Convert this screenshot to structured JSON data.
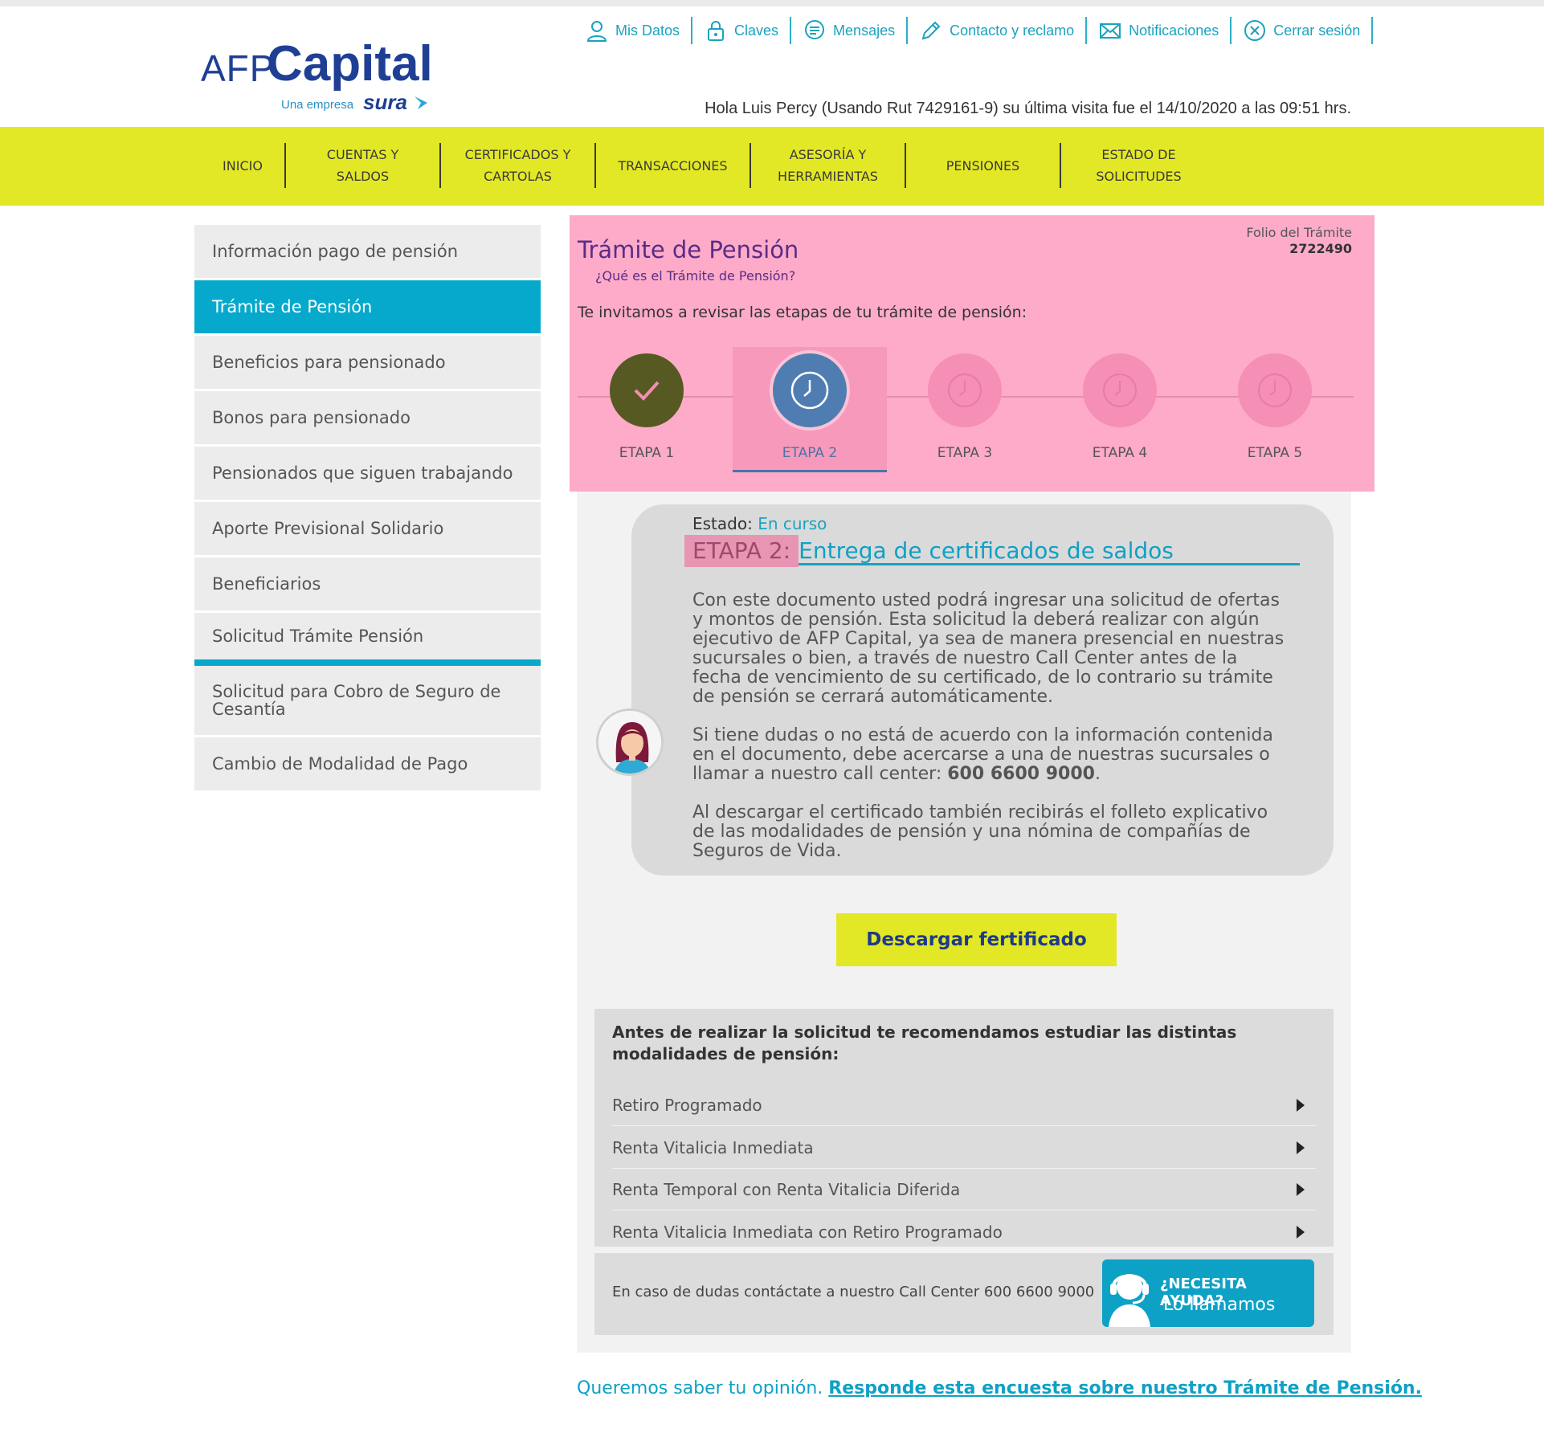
{
  "header": {
    "logo_afp": "AFP",
    "logo_capital": "Capital",
    "logo_una_empresa": "Una empresa",
    "logo_sura": "sura",
    "top_links": [
      {
        "label": "Mis Datos",
        "icon": "user-icon"
      },
      {
        "label": "Claves",
        "icon": "lock-icon"
      },
      {
        "label": "Mensajes",
        "icon": "chat-icon"
      },
      {
        "label": "Contacto y reclamo",
        "icon": "pencil-icon"
      },
      {
        "label": "Notificaciones",
        "icon": "envelope-icon"
      },
      {
        "label": "Cerrar sesión",
        "icon": "close-circle-icon"
      }
    ],
    "greeting": "Hola Luis Percy (Usando Rut 7429161-9) su última visita fue el 14/10/2020 a las 09:51 hrs."
  },
  "nav": {
    "items": [
      "INICIO",
      "CUENTAS Y\nSALDOS",
      "CERTIFICADOS Y\nCARTOLAS",
      "TRANSACCIONES",
      "ASESORÍA Y\nHERRAMIENTAS",
      "PENSIONES",
      "ESTADO DE\nSOLICITUDES"
    ]
  },
  "sidebar": {
    "items": [
      {
        "label": "Información pago de pensión"
      },
      {
        "label": "Trámite de Pensión",
        "active": true
      },
      {
        "label": "Beneficios para pensionado"
      },
      {
        "label": "Bonos para pensionado"
      },
      {
        "label": "Pensionados que siguen trabajando"
      },
      {
        "label": "Aporte Previsional Solidario"
      },
      {
        "label": "Beneficiarios"
      },
      {
        "label": "Solicitud Trámite Pensión"
      },
      {
        "label": "Solicitud para Cobro de Seguro de Cesantía"
      },
      {
        "label": "Cambio de Modalidad de Pago"
      }
    ]
  },
  "tramite": {
    "title": "Trámite de Pensión",
    "subtitle": "¿Qué es el Trámite de Pensión?",
    "folio_label": "Folio del Trámite",
    "folio_value": "2722490",
    "invite": "Te invitamos a revisar las etapas de tu trámite de pensión:",
    "steps": [
      {
        "label": "ETAPA 1",
        "status": "done"
      },
      {
        "label": "ETAPA 2",
        "status": "current"
      },
      {
        "label": "ETAPA 3",
        "status": "pending"
      },
      {
        "label": "ETAPA 4",
        "status": "pending"
      },
      {
        "label": "ETAPA 5",
        "status": "pending"
      }
    ]
  },
  "detail": {
    "estado_label": "Estado:",
    "estado_value": "En curso",
    "etapa_tag": "ETAPA 2:",
    "etapa_name": "Entrega de certificados de saldos",
    "para1": "Con este documento usted podrá ingresar una solicitud de ofertas y montos de pensión. Esta solicitud la deberá realizar con algún ejecutivo de AFP Capital, ya sea de manera presencial en nuestras sucursales o bien, a través de nuestro Call Center antes de la fecha de vencimiento de su certificado, de lo contrario su trámite de pensión se cerrará automáticamente.",
    "para2_text": "Si tiene dudas o no está de acuerdo con la información contenida en el documento, debe acercarse a una de nuestras sucursales o llamar a nuestro call center: ",
    "para2_phone": "600 6600 9000",
    "para2_end": ".",
    "para3": "Al descargar el certificado también recibirás el folleto explicativo de las modalidades de pensión y una nómina de compañías de Seguros de Vida.",
    "download_label": "Descargar fertificado"
  },
  "modalidades": {
    "heading": "Antes de realizar la solicitud te recomendamos estudiar las distintas modalidades de pensión:",
    "items": [
      "Retiro Programado",
      "Renta Vitalicia Inmediata",
      "Renta Temporal con Renta Vitalicia Diferida",
      "Renta Vitalicia Inmediata con Retiro Programado"
    ]
  },
  "help": {
    "text": "En caso de dudas contáctate a nuestro Call Center 600 6600 9000",
    "btn_line1": "¿NECESITA AYUDA?",
    "btn_line2": "Lo llamamos"
  },
  "opinion": {
    "text": "Queremos saber tu opinión. ",
    "link": "Responde esta encuesta sobre nuestro Trámite de Pensión."
  },
  "colors": {
    "brand_blue": "#1e3f94",
    "accent_cyan": "#06a9cc",
    "nav_yellow": "#e3e826",
    "panel_pink": "#fdabc9",
    "step_done": "#565a22",
    "step_current": "#4f7db1"
  }
}
